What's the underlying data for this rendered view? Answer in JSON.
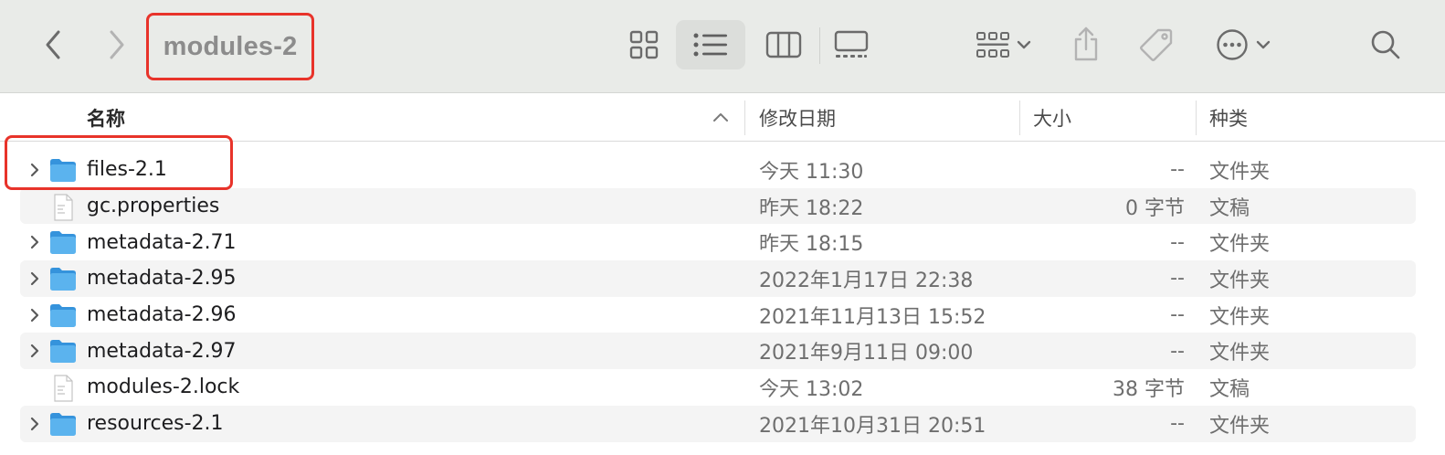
{
  "window": {
    "title": "modules-2"
  },
  "toolbar": {
    "icons": {
      "back": "chevron-left-icon",
      "forward": "chevron-right-icon",
      "icon_view": "grid-view-icon",
      "list_view": "list-view-icon",
      "column_view": "column-view-icon",
      "gallery_view": "gallery-view-icon",
      "group": "group-by-icon",
      "share": "share-icon",
      "tags": "tag-icon",
      "more": "ellipsis-circle-icon",
      "search": "search-icon"
    },
    "selected_view": "list"
  },
  "columns": {
    "name": "名称",
    "date": "修改日期",
    "size": "大小",
    "kind": "种类",
    "sort_column": "name",
    "sort_direction": "ascending"
  },
  "files": [
    {
      "name": "files-2.1",
      "date": "今天 11:30",
      "size": "--",
      "kind": "文件夹",
      "type": "folder"
    },
    {
      "name": "gc.properties",
      "date": "昨天 18:22",
      "size": "0 字节",
      "kind": "文稿",
      "type": "document"
    },
    {
      "name": "metadata-2.71",
      "date": "昨天 18:15",
      "size": "--",
      "kind": "文件夹",
      "type": "folder"
    },
    {
      "name": "metadata-2.95",
      "date": "2022年1月17日 22:38",
      "size": "--",
      "kind": "文件夹",
      "type": "folder"
    },
    {
      "name": "metadata-2.96",
      "date": "2021年11月13日 15:52",
      "size": "--",
      "kind": "文件夹",
      "type": "folder"
    },
    {
      "name": "metadata-2.97",
      "date": "2021年9月11日 09:00",
      "size": "--",
      "kind": "文件夹",
      "type": "folder"
    },
    {
      "name": "modules-2.lock",
      "date": "今天 13:02",
      "size": "38 字节",
      "kind": "文稿",
      "type": "document"
    },
    {
      "name": "resources-2.1",
      "date": "2021年10月31日 20:51",
      "size": "--",
      "kind": "文件夹",
      "type": "folder"
    }
  ],
  "colors": {
    "toolbar_bg": "#e9ebe8",
    "highlight_red": "#e8332a",
    "folder_blue": "#4ba6e8",
    "stripe": "#f4f4f4"
  }
}
